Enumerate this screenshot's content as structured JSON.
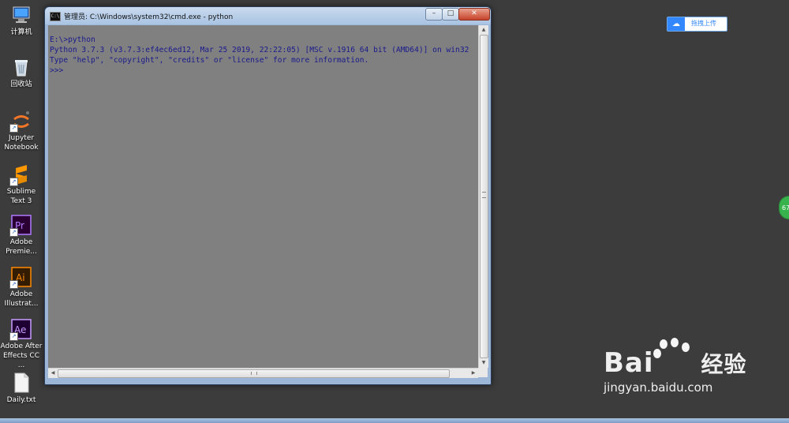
{
  "desktop": {
    "icons": [
      {
        "label": "计算机",
        "icon": "computer-icon"
      },
      {
        "label": "回收站",
        "icon": "recycle-bin-icon"
      },
      {
        "label": "Jupyter Notebook",
        "icon": "jupyter-icon"
      },
      {
        "label": "Sublime Text 3",
        "icon": "sublime-icon"
      },
      {
        "label": "Adobe Premie...",
        "icon": "premiere-icon"
      },
      {
        "label": "Adobe Illustrat...",
        "icon": "illustrator-icon"
      },
      {
        "label": "Adobe After Effects CC ...",
        "icon": "after-effects-icon"
      },
      {
        "label": "Daily.txt",
        "icon": "text-file-icon"
      }
    ]
  },
  "window": {
    "title": "管理员: C:\\Windows\\system32\\cmd.exe - python",
    "icon_text": "C:\\",
    "minimize": "–",
    "maximize": "□",
    "close": "✕"
  },
  "console": {
    "lines": [
      "E:\\>python",
      "Python 3.7.3 (v3.7.3:ef4ec6ed12, Mar 25 2019, 22:22:05) [MSC v.1916 64 bit (AMD64)] on win32",
      "Type \"help\", \"copyright\", \"credits\" or \"license\" for more information.",
      ">>>"
    ]
  },
  "upload_button": {
    "label": "拖拽上传"
  },
  "side_badge": {
    "label": "67"
  },
  "watermark": {
    "brand_latin": "Bai",
    "brand_cn": "经验",
    "url": "jingyan.baidu.com"
  },
  "colors": {
    "console_bg": "#808080",
    "console_text": "#1a1a8c",
    "accent_blue": "#3388ff",
    "desktop_bg": "#3c3c3c"
  }
}
